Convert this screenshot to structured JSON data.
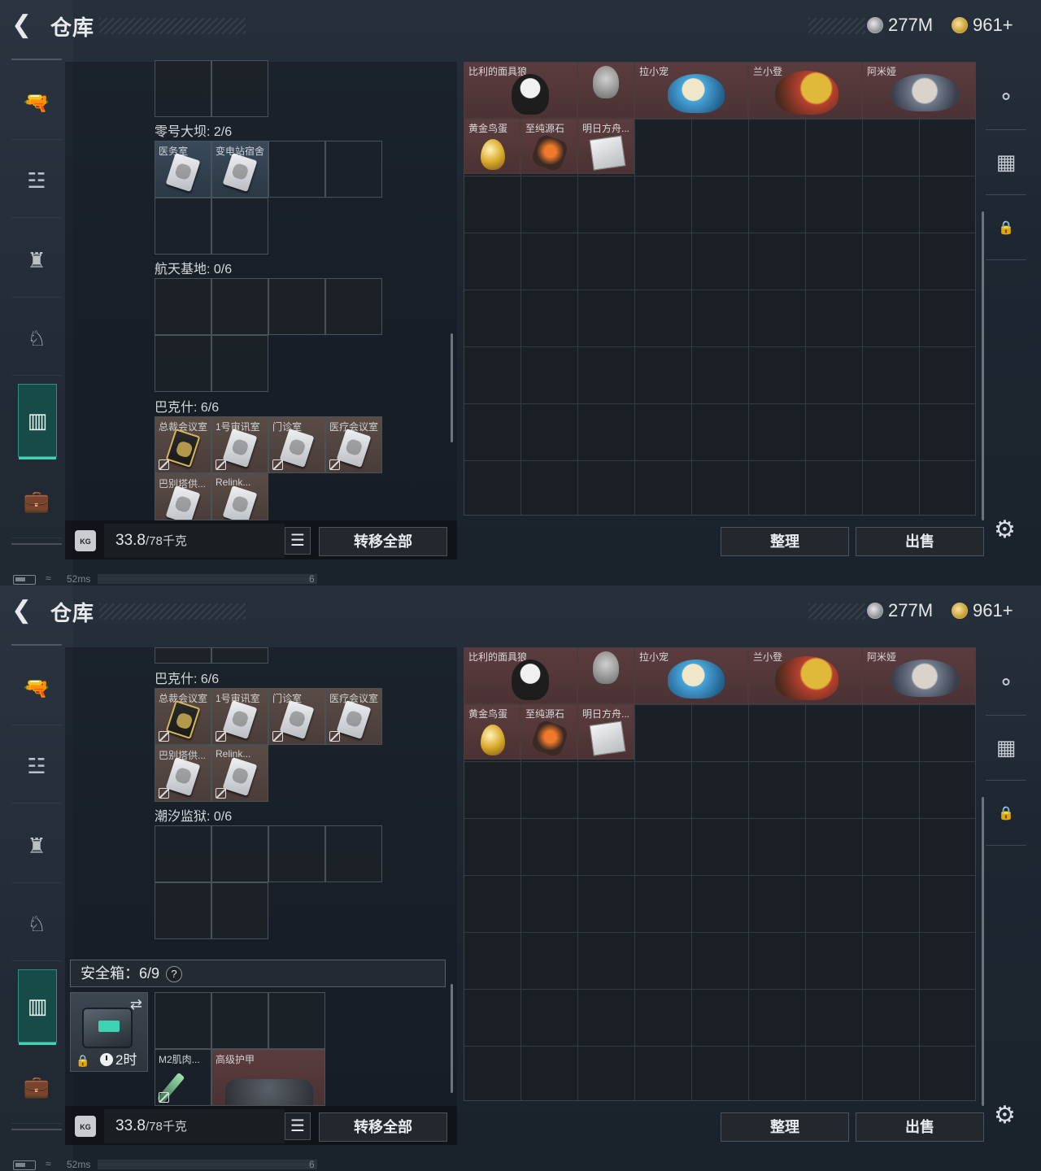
{
  "top": {
    "title": "仓库",
    "currency_silver": "277M",
    "currency_gold": "961+"
  },
  "sidebar": {
    "items": [
      "gun-icon",
      "armor-icon",
      "backpack-icon",
      "chest-rig-icon",
      "keycard-case-icon",
      "briefcase-icon"
    ],
    "active_index": 4
  },
  "left_panel": {
    "screen1": {
      "sections": [
        {
          "title": "零号大坝: 2/6",
          "cells": [
            "医务室",
            "变电站宿舍"
          ]
        },
        {
          "title": "航天基地: 0/6",
          "cells": []
        },
        {
          "title": "巴克什: 6/6",
          "cells": [
            "总裁会议室",
            "1号审讯室",
            "门诊室",
            "医疗会议室",
            "巴别塔供...",
            "Relink..."
          ]
        }
      ]
    },
    "screen2": {
      "sections": [
        {
          "title": "巴克什: 6/6",
          "cells": [
            "总裁会议室",
            "1号审讯室",
            "门诊室",
            "医疗会议室",
            "巴别塔供...",
            "Relink..."
          ]
        },
        {
          "title": "潮汐监狱: 0/6",
          "cells": []
        }
      ],
      "safebox": {
        "title": "安全箱：6/9",
        "help": "?",
        "timer": "2时",
        "items": [
          "M2肌肉...",
          "高级护甲"
        ]
      }
    }
  },
  "bottom": {
    "weight_value": "33.8",
    "weight_max": "/78千克",
    "kg_label": "KG",
    "transfer_all": "转移全部",
    "organize": "整理",
    "sell": "出售"
  },
  "stash": {
    "row1": [
      "比利的面具狼",
      "",
      "拉小宠",
      "兰小登",
      "阿米娅"
    ],
    "row2": [
      "黄金鸟蛋",
      "至纯源石",
      "明日方舟..."
    ]
  },
  "status": {
    "ping": "52ms",
    "count": "6"
  },
  "colors": {
    "accent_teal": "#3fd3b3",
    "item_red": "#5b3c3e",
    "item_blue": "#3a4a5b",
    "item_brown": "#5a4b46"
  }
}
